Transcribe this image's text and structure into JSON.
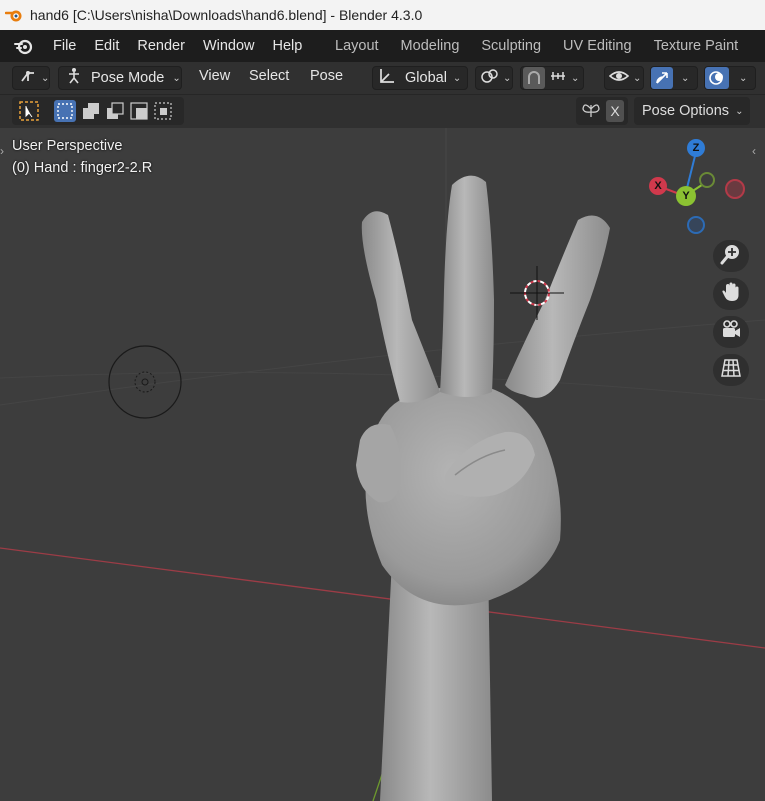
{
  "window": {
    "title": "hand6 [C:\\Users\\nisha\\Downloads\\hand6.blend] - Blender 4.3.0"
  },
  "menu": {
    "items": [
      "File",
      "Edit",
      "Render",
      "Window",
      "Help"
    ]
  },
  "workspaces": [
    "Layout",
    "Modeling",
    "Sculpting",
    "UV Editing",
    "Texture Paint"
  ],
  "header": {
    "mode": "Pose Mode",
    "menus": [
      "View",
      "Select",
      "Pose"
    ],
    "transform_orientation": "Global"
  },
  "tool_settings": {
    "x_label": "X",
    "pose_options": "Pose Options"
  },
  "viewport": {
    "perspective": "User Perspective",
    "active": "(0) Hand : finger2-2.R"
  },
  "gizmo": {
    "z": "Z",
    "x": "X",
    "y": "Y"
  },
  "colors": {
    "accent": "#4772b3",
    "x_axis": "#d0394c",
    "y_axis": "#8bc232",
    "z_axis": "#2f7cd6",
    "cursor_orange": "#e8a13a"
  },
  "icons": [
    "blender-logo-icon",
    "armature-icon",
    "pose-mode-icon",
    "global-orientation-icon",
    "pivot-icon",
    "snap-icon",
    "proportional-icon",
    "visibility-icon",
    "gizmo-icon",
    "overlay-icon",
    "select-box-icon",
    "zoom-icon",
    "hand-icon",
    "camera-icon",
    "grid-icon"
  ]
}
